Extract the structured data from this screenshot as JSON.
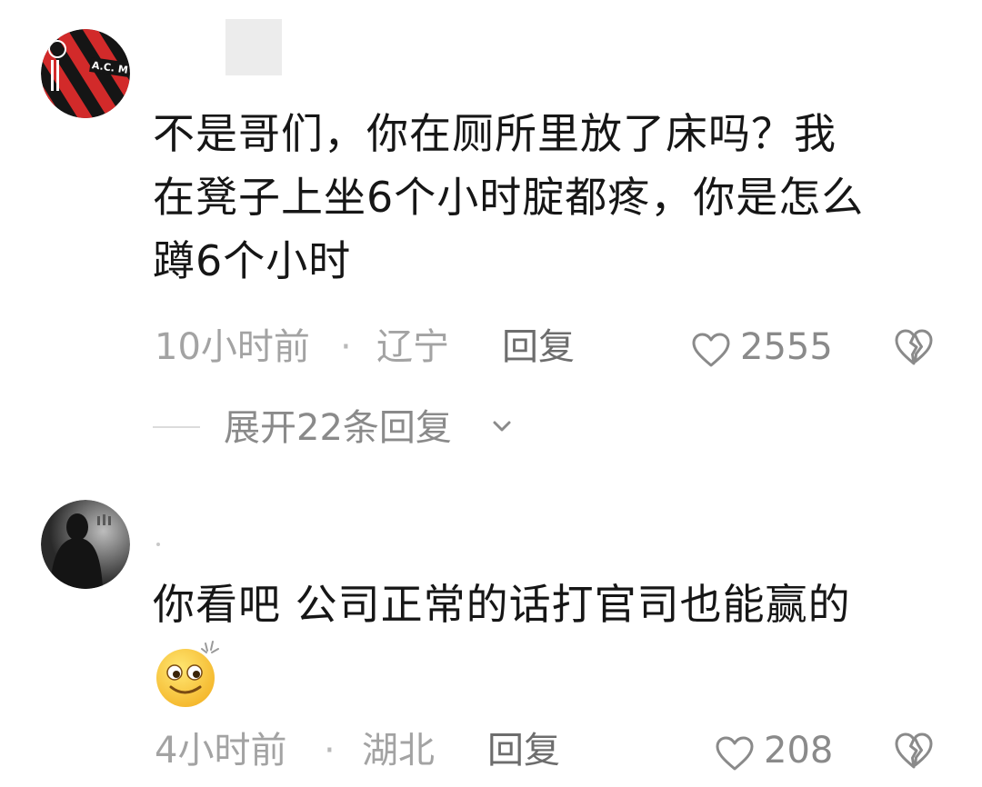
{
  "comments": [
    {
      "avatar": "ac-milan-stripes-avatar",
      "text_lines": [
        "不是哥们，你在厕所里放了床吗？我",
        "在凳子上坐6个小时腚都疼，你是怎么",
        "蹲6个小时"
      ],
      "time": "10小时前",
      "separator": "·",
      "location": "辽宁",
      "reply_label": "回复",
      "like_icon": "heart-outline-icon",
      "likes": "2555",
      "dislike_icon": "broken-heart-icon",
      "expand_replies": "展开22条回复",
      "expand_icon": "chevron-down-icon"
    },
    {
      "avatar": "dark-silhouette-avatar",
      "text_lines": [
        "你看吧 公司正常的话打官司也能赢的"
      ],
      "emoji": "smiling-face-emoji",
      "time": "4小时前",
      "separator": "·",
      "location": "湖北",
      "reply_label": "回复",
      "like_icon": "heart-outline-icon",
      "likes": "208",
      "dislike_icon": "broken-heart-icon"
    }
  ],
  "colors": {
    "text": "#161616",
    "meta": "#a3a3a3",
    "reply": "#6d6d6d",
    "background": "#ffffff",
    "milan_red": "#d22a2a",
    "milan_black": "#151515"
  }
}
